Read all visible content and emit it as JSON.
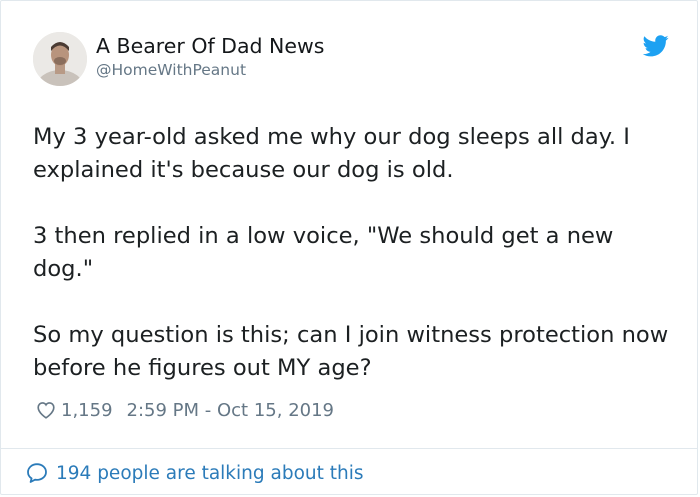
{
  "tweet": {
    "author": {
      "display_name": "A Bearer Of Dad News",
      "handle": "@HomeWithPeanut",
      "avatar_icon": "profile-photo"
    },
    "platform_icon": "twitter-bird-icon",
    "body": "My 3 year-old asked me why our dog sleeps all day. I explained it's because our dog is old.\n\n3 then replied in a low voice, \"We should get a new dog.\"\n\nSo my question is this; can I join witness protection now before he figures out MY age?",
    "likes": "1,159",
    "timestamp": "2:59 PM - Oct 15, 2019",
    "conversation_text": "194 people are talking about this"
  },
  "colors": {
    "brand_blue": "#1da1f2",
    "link_blue": "#2b7bb9",
    "text": "#1c2022",
    "secondary": "#657786",
    "border": "#e1e8ed"
  }
}
